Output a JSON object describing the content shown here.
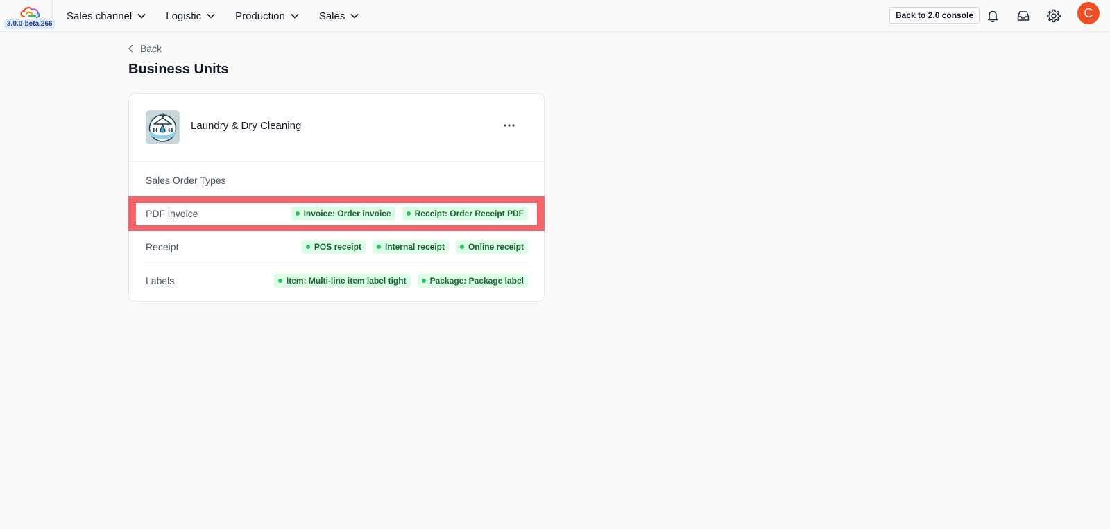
{
  "app": {
    "version": "3.0.0-beta.266",
    "brand_colors": [
      "#f04e23",
      "#22c55e",
      "#3b82f6",
      "#a855f7",
      "#f59e0b"
    ]
  },
  "nav": {
    "items": [
      {
        "label": "Sales channel"
      },
      {
        "label": "Logistic"
      },
      {
        "label": "Production"
      },
      {
        "label": "Sales"
      }
    ]
  },
  "header": {
    "console_button": "Back to 2.0 console",
    "avatar_initial": "C",
    "avatar_color": "#f04e23"
  },
  "page": {
    "back_label": "Back",
    "title": "Business Units"
  },
  "business_unit": {
    "name": "Laundry & Dry Cleaning",
    "section_label": "Sales Order Types",
    "rows": [
      {
        "label": "PDF invoice",
        "highlighted": true,
        "tags": [
          "Invoice: Order invoice",
          "Receipt: Order Receipt PDF"
        ]
      },
      {
        "label": "Receipt",
        "highlighted": false,
        "tags": [
          "POS receipt",
          "Internal receipt",
          "Online receipt"
        ]
      },
      {
        "label": "Labels",
        "highlighted": false,
        "tags": [
          "Item: Multi-line item label tight",
          "Package: Package label"
        ]
      }
    ]
  },
  "colors": {
    "tag_bg": "#dcfce7",
    "tag_text": "#166534",
    "tag_dot": "#22c55e",
    "highlight": "#f3646b"
  }
}
